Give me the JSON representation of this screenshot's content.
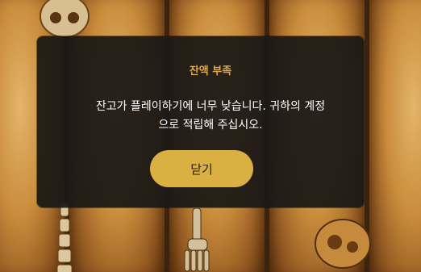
{
  "dialog": {
    "title": "잔액 부족",
    "message_line1": "잔고가 플레이하기에 너무 낮습니다. 귀하의 계정",
    "message_line2": "으로 적립해 주십시오.",
    "close_label": "닫기"
  },
  "colors": {
    "title": "#e0a94a",
    "button": "#d9b041",
    "overlay": "#1c1816"
  },
  "background": {
    "symbols": [
      "skull-icon",
      "spine-icon",
      "foot-bones-icon",
      "hip-bone-icon"
    ]
  }
}
